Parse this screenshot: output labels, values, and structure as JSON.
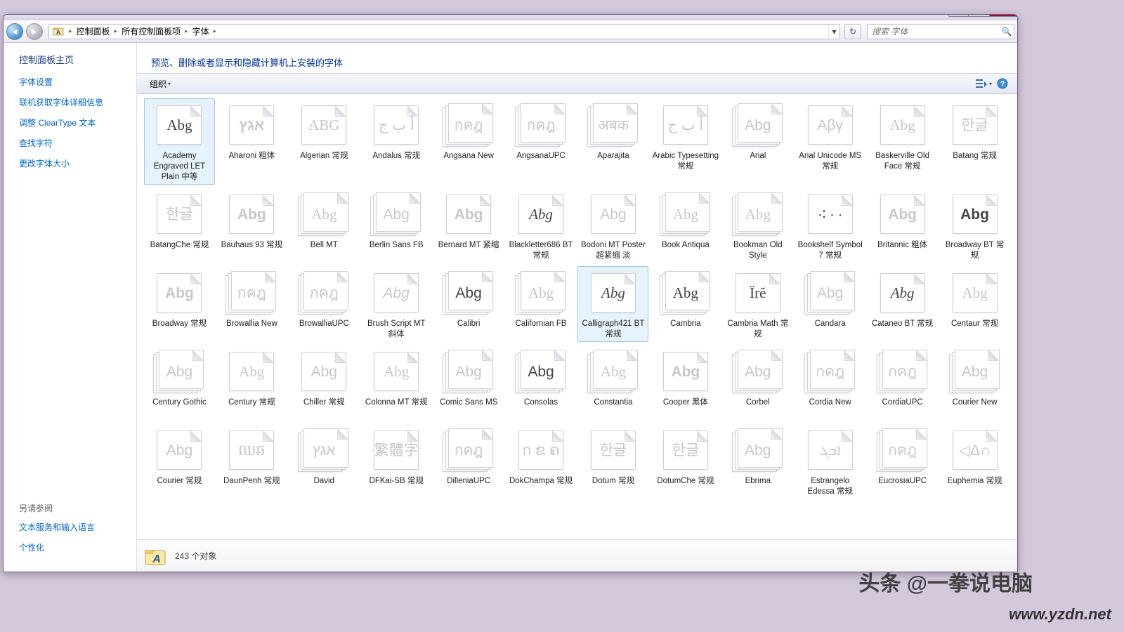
{
  "window": {
    "min": "─",
    "max": "☐",
    "close": "✕"
  },
  "nav": {
    "back": "◄",
    "fwd": "►",
    "refresh": "↻",
    "crumbs": [
      "控制面板",
      "所有控制面板项",
      "字体"
    ],
    "sep": "▸",
    "drop": "▾",
    "search_ph": "搜索 字体"
  },
  "sidebar": {
    "title": "控制面板主页",
    "links": [
      "字体设置",
      "联机获取字体详细信息",
      "调整 ClearType 文本",
      "查找字符",
      "更改字体大小"
    ],
    "see_also": "另请参阅",
    "refs": [
      "文本服务和输入语言",
      "个性化"
    ]
  },
  "main": {
    "heading": "预览、删除或者显示和隐藏计算机上安装的字体",
    "organize": "组织",
    "drop": "▾",
    "view_icon": "☰",
    "help": "?"
  },
  "status": {
    "count_text": "243 个对象"
  },
  "fonts": [
    {
      "n": "Academy Engraved LET Plain 中等",
      "s": "Abg",
      "c": "dark serif",
      "t": "single",
      "sel": true
    },
    {
      "n": "Aharoni 粗体",
      "s": "אגץ",
      "c": "dim bold",
      "t": "single"
    },
    {
      "n": "Algerian 常规",
      "s": "ABG",
      "c": "dim serif",
      "t": "single"
    },
    {
      "n": "Andalus 常规",
      "s": "أ ب ج",
      "c": "dim",
      "t": "single"
    },
    {
      "n": "Angsana New",
      "s": "กคฎ",
      "c": "dim",
      "t": "stack"
    },
    {
      "n": "AngsanaUPC",
      "s": "กคฎ",
      "c": "dim",
      "t": "stack"
    },
    {
      "n": "Aparajita",
      "s": "अबक",
      "c": "dim",
      "t": "stack"
    },
    {
      "n": "Arabic Typesetting 常规",
      "s": "أ ب ج",
      "c": "dim",
      "t": "single"
    },
    {
      "n": "Arial",
      "s": "Abg",
      "c": "dim",
      "t": "stack"
    },
    {
      "n": "Arial Unicode MS 常规",
      "s": "Aβγ",
      "c": "dim",
      "t": "single"
    },
    {
      "n": "Baskerville Old Face 常规",
      "s": "Abg",
      "c": "dim serif",
      "t": "single"
    },
    {
      "n": "Batang 常规",
      "s": "한글",
      "c": "dim",
      "t": "single"
    },
    {
      "n": "BatangChe 常规",
      "s": "한글",
      "c": "dim",
      "t": "single"
    },
    {
      "n": "Bauhaus 93 常规",
      "s": "Abg",
      "c": "dim bold",
      "t": "single"
    },
    {
      "n": "Bell MT",
      "s": "Abg",
      "c": "dim serif",
      "t": "stack"
    },
    {
      "n": "Berlin Sans FB",
      "s": "Abg",
      "c": "dim",
      "t": "stack"
    },
    {
      "n": "Bernard MT 紧缩",
      "s": "Abg",
      "c": "dim bold",
      "t": "single"
    },
    {
      "n": "Blackletter686 BT 常规",
      "s": "Abg",
      "c": "dark serif ital",
      "t": "single"
    },
    {
      "n": "Bodoni MT Poster 超紧缩 淡",
      "s": "Abg",
      "c": "dim",
      "t": "single"
    },
    {
      "n": "Book Antiqua",
      "s": "Abg",
      "c": "dim serif",
      "t": "stack"
    },
    {
      "n": "Bookman Old Style",
      "s": "Abg",
      "c": "dim serif",
      "t": "stack"
    },
    {
      "n": "Bookshelf Symbol 7 常规",
      "s": "∙∶ ∙ ∙",
      "c": "dark",
      "t": "single"
    },
    {
      "n": "Britannic 粗体",
      "s": "Abg",
      "c": "dim bold",
      "t": "single"
    },
    {
      "n": "Broadway BT 常规",
      "s": "Abg",
      "c": "dark bold",
      "t": "single"
    },
    {
      "n": "Broadway 常规",
      "s": "Abg",
      "c": "dim bold",
      "t": "single"
    },
    {
      "n": "Browallia New",
      "s": "กคฎ",
      "c": "dim",
      "t": "stack"
    },
    {
      "n": "BrowalliaUPC",
      "s": "กคฎ",
      "c": "dim",
      "t": "stack"
    },
    {
      "n": "Brush Script MT 斜体",
      "s": "Abg",
      "c": "dim ital",
      "t": "single"
    },
    {
      "n": "Calibri",
      "s": "Abg",
      "c": "dark",
      "t": "stack"
    },
    {
      "n": "Californian FB",
      "s": "Abg",
      "c": "dim serif",
      "t": "stack"
    },
    {
      "n": "Calligraph421 BT 常规",
      "s": "Abg",
      "c": "dark ital serif",
      "t": "single",
      "sel": true
    },
    {
      "n": "Cambria",
      "s": "Abg",
      "c": "dark serif",
      "t": "stack"
    },
    {
      "n": "Cambria Math 常规",
      "s": "Ïrĕ",
      "c": "dark serif",
      "t": "single"
    },
    {
      "n": "Candara",
      "s": "Abg",
      "c": "dim",
      "t": "stack"
    },
    {
      "n": "Cataneo BT 常规",
      "s": "Abg",
      "c": "dark ital serif",
      "t": "single"
    },
    {
      "n": "Centaur 常规",
      "s": "Abg",
      "c": "dim serif",
      "t": "single"
    },
    {
      "n": "Century Gothic",
      "s": "Abg",
      "c": "dim",
      "t": "stack"
    },
    {
      "n": "Century 常规",
      "s": "Abg",
      "c": "dim serif",
      "t": "single"
    },
    {
      "n": "Chiller 常规",
      "s": "Abg",
      "c": "dim",
      "t": "single"
    },
    {
      "n": "Colonna MT 常规",
      "s": "Abg",
      "c": "dim serif",
      "t": "single"
    },
    {
      "n": "Comic Sans MS",
      "s": "Abg",
      "c": "dim",
      "t": "stack"
    },
    {
      "n": "Consolas",
      "s": "Abg",
      "c": "dark",
      "t": "stack"
    },
    {
      "n": "Constantia",
      "s": "Abg",
      "c": "dim serif",
      "t": "stack"
    },
    {
      "n": "Cooper 黑体",
      "s": "Abg",
      "c": "dim bold",
      "t": "single"
    },
    {
      "n": "Corbel",
      "s": "Abg",
      "c": "dim",
      "t": "stack"
    },
    {
      "n": "Cordia New",
      "s": "กคฎ",
      "c": "dim",
      "t": "stack"
    },
    {
      "n": "CordiaUPC",
      "s": "กคฎ",
      "c": "dim",
      "t": "stack"
    },
    {
      "n": "Courier New",
      "s": "Abg",
      "c": "dim",
      "t": "stack"
    },
    {
      "n": "Courier 常规",
      "s": "Abg",
      "c": "dim",
      "t": "single"
    },
    {
      "n": "DaunPenh 常规",
      "s": "ឈឆ",
      "c": "dim",
      "t": "single"
    },
    {
      "n": "David",
      "s": "אגץ",
      "c": "dim",
      "t": "stack"
    },
    {
      "n": "DFKai-SB 常规",
      "s": "繁體字",
      "c": "dim",
      "t": "single"
    },
    {
      "n": "DilleniaUPC",
      "s": "กคฎ",
      "c": "dim",
      "t": "stack"
    },
    {
      "n": "DokChampa 常规",
      "s": "ก ຂ ຄ",
      "c": "dim",
      "t": "single"
    },
    {
      "n": "Dotum 常规",
      "s": "한글",
      "c": "dim",
      "t": "single"
    },
    {
      "n": "DotumChe 常规",
      "s": "한글",
      "c": "dim",
      "t": "single"
    },
    {
      "n": "Ebrima",
      "s": "Abg",
      "c": "dim",
      "t": "stack"
    },
    {
      "n": "Estrangelo Edessa 常规",
      "s": "ܐܒܓ",
      "c": "dim",
      "t": "single"
    },
    {
      "n": "EucrosiaUPC",
      "s": "กคฎ",
      "c": "dim",
      "t": "stack"
    },
    {
      "n": "Euphemia 常规",
      "s": "◁Δ∩",
      "c": "dim",
      "t": "single"
    }
  ],
  "wm1": "头条 @一拳说电脑",
  "wm2": "www.yzdn.net"
}
